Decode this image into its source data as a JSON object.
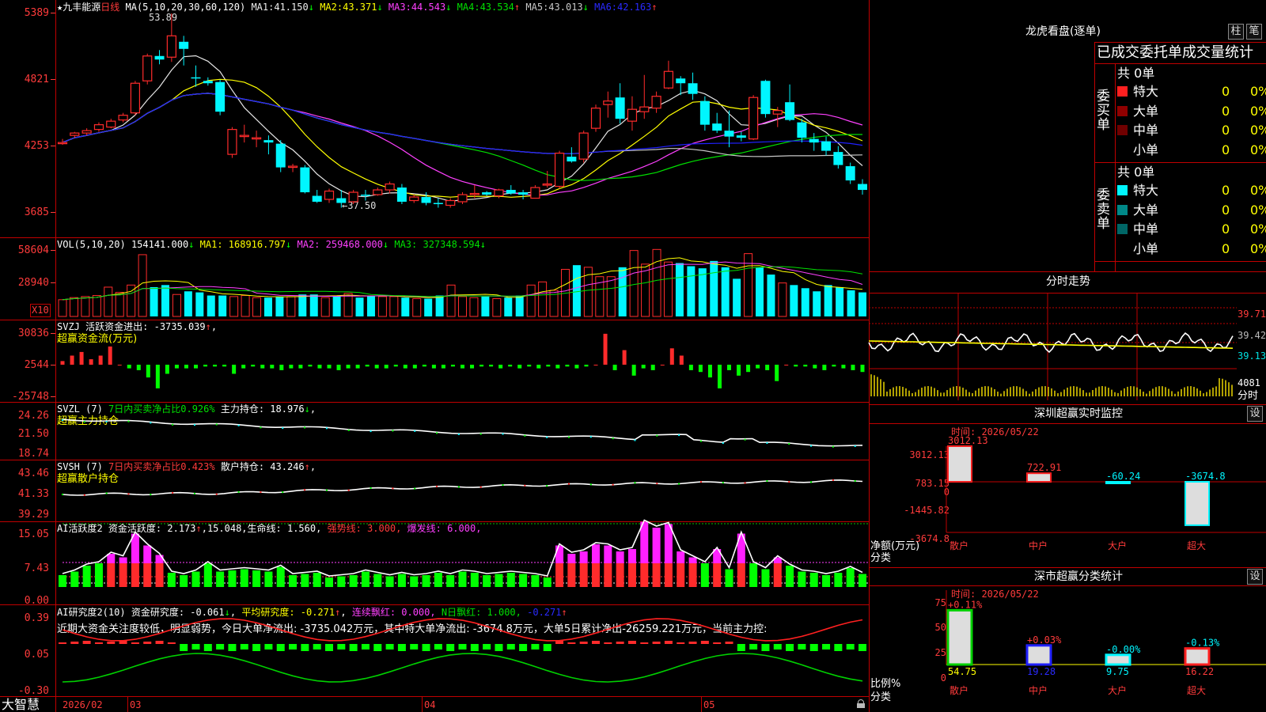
{
  "app": {
    "brand": "大智慧",
    "stock_name": "九丰能源",
    "period": "日线"
  },
  "colors": {
    "up": "#ff2b2b",
    "down": "#00f6ff",
    "frame": "#c00000",
    "ma1": "#e6e6e6",
    "ma2": "#ffff00",
    "ma3": "#ff40ff",
    "ma4": "#00e000",
    "ma5": "#c8c8c8",
    "ma6": "#2020ff",
    "green": "#00ff00"
  },
  "main": {
    "ma_header": "MA(5,10,20,30,60,120)",
    "ma": [
      {
        "label": "MA1:",
        "value": "41.150",
        "arrow": "↓"
      },
      {
        "label": "MA2:",
        "value": "43.371",
        "arrow": "↓"
      },
      {
        "label": "MA3:",
        "value": "44.543",
        "arrow": "↓"
      },
      {
        "label": "MA4:",
        "value": "43.534",
        "arrow": "↑"
      },
      {
        "label": "MA5:",
        "value": "43.013",
        "arrow": "↓"
      },
      {
        "label": "MA6:",
        "value": "42.163",
        "arrow": "↑"
      }
    ],
    "high_note": "53.89",
    "low_note": "←37.50",
    "y_labels": [
      "5389",
      "4821",
      "4253",
      "3685"
    ]
  },
  "vol": {
    "header": "VOL(5,10,20)",
    "value": "154141.000",
    "ma1": "MA1: 168916.797",
    "ma2": "MA2: 259468.000",
    "ma3": "MA3: 327348.594",
    "arrows": [
      "↓",
      "↓",
      "↓",
      "↓"
    ],
    "y_labels": [
      "58604",
      "28940"
    ],
    "unit": "X10"
  },
  "svzj": {
    "header": "SVZJ",
    "label": "活跃资金进出: -3735.039",
    "arrow": "↑",
    "tail": ",",
    "sub": "超赢资金流(万元)",
    "y_labels": [
      "30836",
      "2544",
      "-25748"
    ]
  },
  "svzl": {
    "header": "SVZL (7)",
    "desc": "7日内买卖净占比0.926%",
    "label": "主力持仓: 18.976",
    "arrow": "↓",
    "tail": ",",
    "sub": "超赢主力持仓",
    "y_labels": [
      "24.26",
      "21.50",
      "18.74"
    ]
  },
  "svsh": {
    "header": "SVSH (7)",
    "desc": "7日内买卖净占比0.423%",
    "label": "散户持仓: 43.246",
    "arrow": "↑",
    "tail": ",",
    "sub": "超赢散户持仓",
    "y_labels": [
      "43.46",
      "41.33",
      "39.29"
    ]
  },
  "ai1": {
    "header": "AI活跃度2",
    "a": "资金活跃度: 2.173",
    "a_arrow": "↑",
    "b": ",15.048,",
    "c": "生命线: 1.560,",
    "d": "强势线: 3.000,",
    "e": "爆发线: 6.000,",
    "y_labels": [
      "15.05",
      "7.43",
      "0.00"
    ]
  },
  "ai2": {
    "header": "AI研究度2(10)",
    "a": "资金研究度: -0.061",
    "a_arrow": "↓",
    "b": "平均研究度: -0.271",
    "b_arrow": "↑",
    "c": "连续飘红: 0.000,",
    "d": "N日飘红: 1.000,",
    "e": "-0.271",
    "e_arrow": "↑",
    "comment": "近期大资金关注度较低，明显弱势，今日大单净流出: -3735.042万元，其中特大单净流出: -3674.8万元，大单5日累计净出-26259.221万元，当前主力控:",
    "y_labels": [
      "0.39",
      "0.05",
      "-0.30"
    ]
  },
  "xaxis": {
    "labels": [
      "2026/02",
      "03",
      "04",
      "05"
    ]
  },
  "dragon": {
    "title": "龙虎看盘(逐单)",
    "btn_col": "柱",
    "btn_pen": "笔",
    "header": "已成交委托单成交量统计",
    "buy_label": "委买单",
    "sell_label": "委卖单",
    "total_buy": "共 0单",
    "total_sell": "共 0单",
    "buy_rows": [
      {
        "name": "特大",
        "qty": "0",
        "pct": "0%"
      },
      {
        "name": "大单",
        "qty": "0",
        "pct": "0%"
      },
      {
        "name": "中单",
        "qty": "0",
        "pct": "0%"
      },
      {
        "name": "小单",
        "qty": "0",
        "pct": "0%"
      }
    ],
    "sell_rows": [
      {
        "name": "特大",
        "qty": "0",
        "pct": "0%"
      },
      {
        "name": "大单",
        "qty": "0",
        "pct": "0%"
      },
      {
        "name": "中单",
        "qty": "0",
        "pct": "0%"
      },
      {
        "name": "小单",
        "qty": "0",
        "pct": "0%"
      }
    ]
  },
  "intraday": {
    "title": "分时走势",
    "y_labels": [
      "39.71",
      "39.42",
      "39.13"
    ],
    "vol_label": "4081",
    "vol_unit": "分时"
  },
  "sz_monitor": {
    "title": "深圳超赢实时监控",
    "btn": "设",
    "time": "时间: 2026/05/22",
    "y_labels": [
      "3012.13",
      "783.15",
      "0",
      "-1445.82",
      "-3674.8"
    ],
    "y_unit": "净额(万元)",
    "x_unit": "分类"
  },
  "sz_stats": {
    "title": "深市超赢分类统计",
    "btn": "设",
    "time": "时间: 2026/05/22",
    "y_labels": [
      "75",
      "50",
      "25",
      "0"
    ],
    "y_unit": "比例%",
    "x_unit": "分类"
  },
  "chart_data": [
    {
      "type": "candlestick",
      "title": "九丰能源 日线",
      "ohlc": [
        [
          42.9,
          43.3,
          42.8,
          43.0
        ],
        [
          43.6,
          43.9,
          43.4,
          43.8
        ],
        [
          43.8,
          44.2,
          43.6,
          44.0
        ],
        [
          44.1,
          44.7,
          43.9,
          44.5
        ],
        [
          44.3,
          45.0,
          44.2,
          44.8
        ],
        [
          44.9,
          45.5,
          44.7,
          45.3
        ],
        [
          45.5,
          48.2,
          45.3,
          48.0
        ],
        [
          48.2,
          50.5,
          47.9,
          50.3
        ],
        [
          50.3,
          50.8,
          49.6,
          50.0
        ],
        [
          50.2,
          53.89,
          49.8,
          52.0
        ],
        [
          51.5,
          52.0,
          49.5,
          50.9
        ],
        [
          48.5,
          49.5,
          47.7,
          48.4
        ],
        [
          48.2,
          48.5,
          47.8,
          48.0
        ],
        [
          48.1,
          48.3,
          45.3,
          45.6
        ],
        [
          42.0,
          44.3,
          41.7,
          44.1
        ],
        [
          43.5,
          44.5,
          43.0,
          43.6
        ],
        [
          43.3,
          44.0,
          42.6,
          43.4
        ],
        [
          43.2,
          43.6,
          42.0,
          43.0
        ],
        [
          42.9,
          43.2,
          40.5,
          40.9
        ],
        [
          40.9,
          41.2,
          40.5,
          41.0
        ],
        [
          40.9,
          41.1,
          38.7,
          38.8
        ],
        [
          38.5,
          39.0,
          37.9,
          38.0
        ],
        [
          38.2,
          39.1,
          37.9,
          38.9
        ],
        [
          38.3,
          39.0,
          37.5,
          37.9
        ],
        [
          38.0,
          39.0,
          37.8,
          38.8
        ],
        [
          38.6,
          39.0,
          38.1,
          38.5
        ],
        [
          38.6,
          39.2,
          38.5,
          39.0
        ],
        [
          39.0,
          39.7,
          38.7,
          39.5
        ],
        [
          39.2,
          39.5,
          37.8,
          38.0
        ],
        [
          38.1,
          38.6,
          37.9,
          38.4
        ],
        [
          38.4,
          38.8,
          37.7,
          37.9
        ],
        [
          37.9,
          38.3,
          37.5,
          37.8
        ],
        [
          37.7,
          38.3,
          37.5,
          38.1
        ],
        [
          38.0,
          38.8,
          37.8,
          38.6
        ],
        [
          38.6,
          39.4,
          38.3,
          38.7
        ],
        [
          38.8,
          38.9,
          38.5,
          38.6
        ],
        [
          38.5,
          39.1,
          38.3,
          39.0
        ],
        [
          39.0,
          39.4,
          38.6,
          38.7
        ],
        [
          38.8,
          39.0,
          38.2,
          38.6
        ],
        [
          38.3,
          39.4,
          38.3,
          39.2
        ],
        [
          39.4,
          40.6,
          39.2,
          39.5
        ],
        [
          39.3,
          42.3,
          39.1,
          42.1
        ],
        [
          41.8,
          42.6,
          41.3,
          41.4
        ],
        [
          41.6,
          44.0,
          41.3,
          43.8
        ],
        [
          44.2,
          46.2,
          43.9,
          45.9
        ],
        [
          46.2,
          47.3,
          45.1,
          46.5
        ],
        [
          46.8,
          48.0,
          44.6,
          45.0
        ],
        [
          44.8,
          46.9,
          44.0,
          45.8
        ],
        [
          45.6,
          48.7,
          45.0,
          46.0
        ],
        [
          45.9,
          47.3,
          45.5,
          46.9
        ],
        [
          47.6,
          49.9,
          47.5,
          49.0
        ],
        [
          48.4,
          48.6,
          47.0,
          48.0
        ],
        [
          48.0,
          48.9,
          46.6,
          47.1
        ],
        [
          46.5,
          46.9,
          44.0,
          44.5
        ],
        [
          44.6,
          45.5,
          43.8,
          44.0
        ],
        [
          44.0,
          45.7,
          42.6,
          43.5
        ],
        [
          43.6,
          43.9,
          43.1,
          43.4
        ],
        [
          43.3,
          47.0,
          43.2,
          46.8
        ],
        [
          48.2,
          48.3,
          45.1,
          45.4
        ],
        [
          45.4,
          46.0,
          44.3,
          45.7
        ],
        [
          46.4,
          47.9,
          44.8,
          44.9
        ],
        [
          44.7,
          45.0,
          43.0,
          43.4
        ],
        [
          43.3,
          43.8,
          42.3,
          43.0
        ],
        [
          43.1,
          43.5,
          41.9,
          42.3
        ],
        [
          42.2,
          42.7,
          40.8,
          41.1
        ],
        [
          41.0,
          41.3,
          39.5,
          39.8
        ],
        [
          39.5,
          39.9,
          38.6,
          39.0
        ]
      ],
      "ma_series_names": [
        "MA1",
        "MA2",
        "MA3",
        "MA4",
        "MA5",
        "MA6"
      ],
      "ylim": [
        37.0,
        54.0
      ]
    },
    {
      "type": "bar",
      "title": "VOL(5,10,20)",
      "values": [
        160,
        180,
        190,
        200,
        280,
        230,
        300,
        590,
        280,
        300,
        210,
        240,
        230,
        200,
        200,
        190,
        200,
        180,
        180,
        190,
        190,
        210,
        210,
        180,
        200,
        220,
        180,
        200,
        190,
        190,
        180,
        170,
        170,
        200,
        300,
        190,
        180,
        190,
        170,
        180,
        200,
        300,
        330,
        250,
        450,
        490,
        470,
        380,
        380,
        470,
        630,
        500,
        640,
        520,
        510,
        480,
        460,
        530,
        470,
        360,
        600,
        470,
        400,
        320,
        300,
        270,
        240,
        300,
        280,
        250,
        230
      ],
      "ylim": [
        0,
        650
      ]
    },
    {
      "type": "bar",
      "title": "SVZJ",
      "values": [
        2,
        5,
        7,
        3,
        5,
        10,
        0,
        -2,
        -3,
        -7,
        -13,
        -5,
        -2,
        -2,
        -2,
        -1,
        -1,
        -1,
        -5,
        -2,
        -1,
        -2,
        -2,
        -3,
        -2,
        -2,
        -1,
        -2,
        -2,
        -3,
        -2,
        -2,
        -1,
        -2,
        -2,
        -1,
        -2,
        -2,
        -1,
        -2,
        -2,
        -1,
        -2,
        -2,
        -1,
        -1,
        -2,
        -1,
        -2,
        -1,
        -2,
        -1,
        -2,
        -1,
        -2,
        -1,
        0,
        17,
        -3,
        8,
        -6,
        -2,
        -3,
        0,
        9,
        5,
        -3,
        -4,
        -7,
        -13,
        -3,
        -6,
        -4,
        -2,
        -3,
        -9,
        0,
        -1,
        -1,
        -2,
        -3,
        -1,
        -2,
        -3,
        -4
      ],
      "ylim": [
        -25748,
        30836
      ]
    }
  ]
}
